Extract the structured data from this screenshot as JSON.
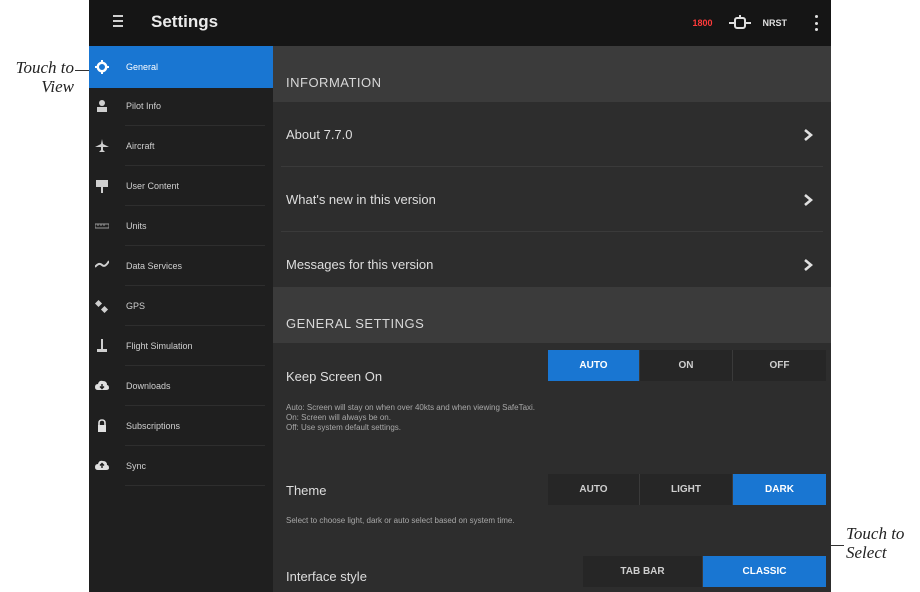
{
  "callouts": {
    "left_line1": "Touch to",
    "left_line2": "View",
    "right_line1": "Touch to",
    "right_line2": "Select"
  },
  "header": {
    "title": "Settings",
    "status_text": "1800",
    "device_label": "NRST",
    "status_color": "#ff3a3a"
  },
  "colors": {
    "accent": "#1976d2",
    "background": "#2d2d2d",
    "sidebar": "#1f1f1f"
  },
  "sidebar": {
    "items": [
      {
        "label": "General",
        "icon": "gear-icon",
        "active": true
      },
      {
        "label": "Pilot Info",
        "icon": "person-icon"
      },
      {
        "label": "Aircraft",
        "icon": "airplane-icon"
      },
      {
        "label": "User Content",
        "icon": "user-content-icon"
      },
      {
        "label": "Units",
        "icon": "ruler-icon"
      },
      {
        "label": "Data Services",
        "icon": "data-services-icon"
      },
      {
        "label": "GPS",
        "icon": "satellite-icon"
      },
      {
        "label": "Flight Simulation",
        "icon": "joystick-icon"
      },
      {
        "label": "Downloads",
        "icon": "cloud-download-icon"
      },
      {
        "label": "Subscriptions",
        "icon": "lock-icon"
      },
      {
        "label": "Sync",
        "icon": "cloud-sync-icon"
      }
    ]
  },
  "information": {
    "header": "INFORMATION",
    "rows": [
      {
        "label": "About 7.7.0"
      },
      {
        "label": "What's new in this version"
      },
      {
        "label": "Messages for this version"
      }
    ]
  },
  "general_settings": {
    "header": "GENERAL SETTINGS",
    "keep_screen_on": {
      "label": "Keep Screen On",
      "options": [
        "AUTO",
        "ON",
        "OFF"
      ],
      "selected": "AUTO",
      "description": [
        "Auto: Screen will stay on when over 40kts and when viewing SafeTaxi.",
        "On: Screen will always be on.",
        "Off: Use system default settings."
      ]
    },
    "theme": {
      "label": "Theme",
      "options": [
        "AUTO",
        "LIGHT",
        "DARK"
      ],
      "selected": "DARK",
      "description": "Select to choose light, dark or auto select based on system time."
    },
    "interface_style": {
      "label": "Interface style",
      "options": [
        "TAB BAR",
        "CLASSIC"
      ],
      "selected": "CLASSIC"
    }
  }
}
